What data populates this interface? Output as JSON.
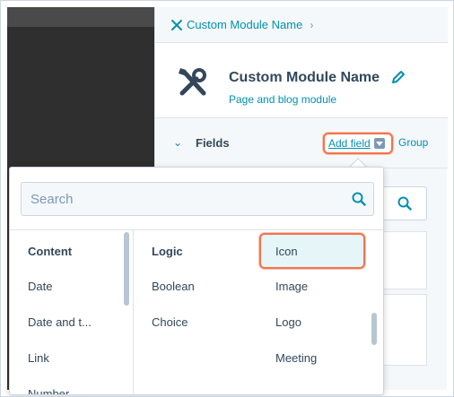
{
  "breadcrumb": {
    "label": "Custom Module Name"
  },
  "module": {
    "title": "Custom Module Name",
    "subtitle": "Page and blog module",
    "icon": "wrench-brush-icon"
  },
  "fields": {
    "label": "Fields",
    "add_field_label": "Add field",
    "group_label": "Group"
  },
  "dropdown": {
    "search_placeholder": "Search",
    "content_column": {
      "heading": "Content",
      "items": [
        "Date",
        "Date and t...",
        "Link",
        "Number"
      ]
    },
    "logic_column": {
      "heading": "Logic",
      "items": [
        "Boolean",
        "Choice"
      ]
    },
    "media_column": {
      "items": [
        "Icon",
        "Image",
        "Logo",
        "Meeting"
      ],
      "highlighted": "Icon"
    }
  },
  "colors": {
    "accent": "#0091ae",
    "highlight_border": "#f2744c",
    "text": "#33475b"
  }
}
